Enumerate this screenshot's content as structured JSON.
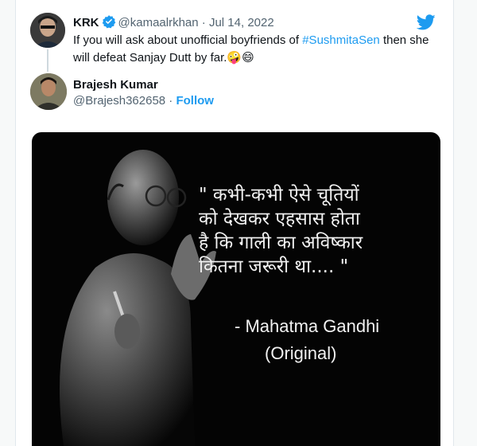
{
  "tweet": {
    "author_name": "KRK",
    "author_handle": "@kamaalrkhan",
    "separator": "·",
    "date": "Jul 14, 2022",
    "text_before": "If you will ask about unofficial boyfriends of ",
    "hashtag": "#SushmitaSen",
    "text_after": " then she will defeat Sanjay Dutt by far.🤪😄"
  },
  "reply": {
    "author_name": "Brajesh Kumar",
    "author_handle": "@Brajesh362658",
    "separator": " · ",
    "follow_label": "Follow"
  },
  "media": {
    "quote": "\" कभी-कभी ऐसे चूतियों\nको देखकर एहसास होता\nहै कि गाली का अविष्कार\nकितना जरूरी था.... \"",
    "attribution": "- Mahatma Gandhi",
    "attribution_note": "(Original)"
  },
  "icons": {
    "brand": "twitter-bird-icon",
    "verified": "verified-badge-icon"
  },
  "colors": {
    "link_blue": "#1d9bf0",
    "secondary_text": "#536471",
    "media_bg": "#040404"
  }
}
